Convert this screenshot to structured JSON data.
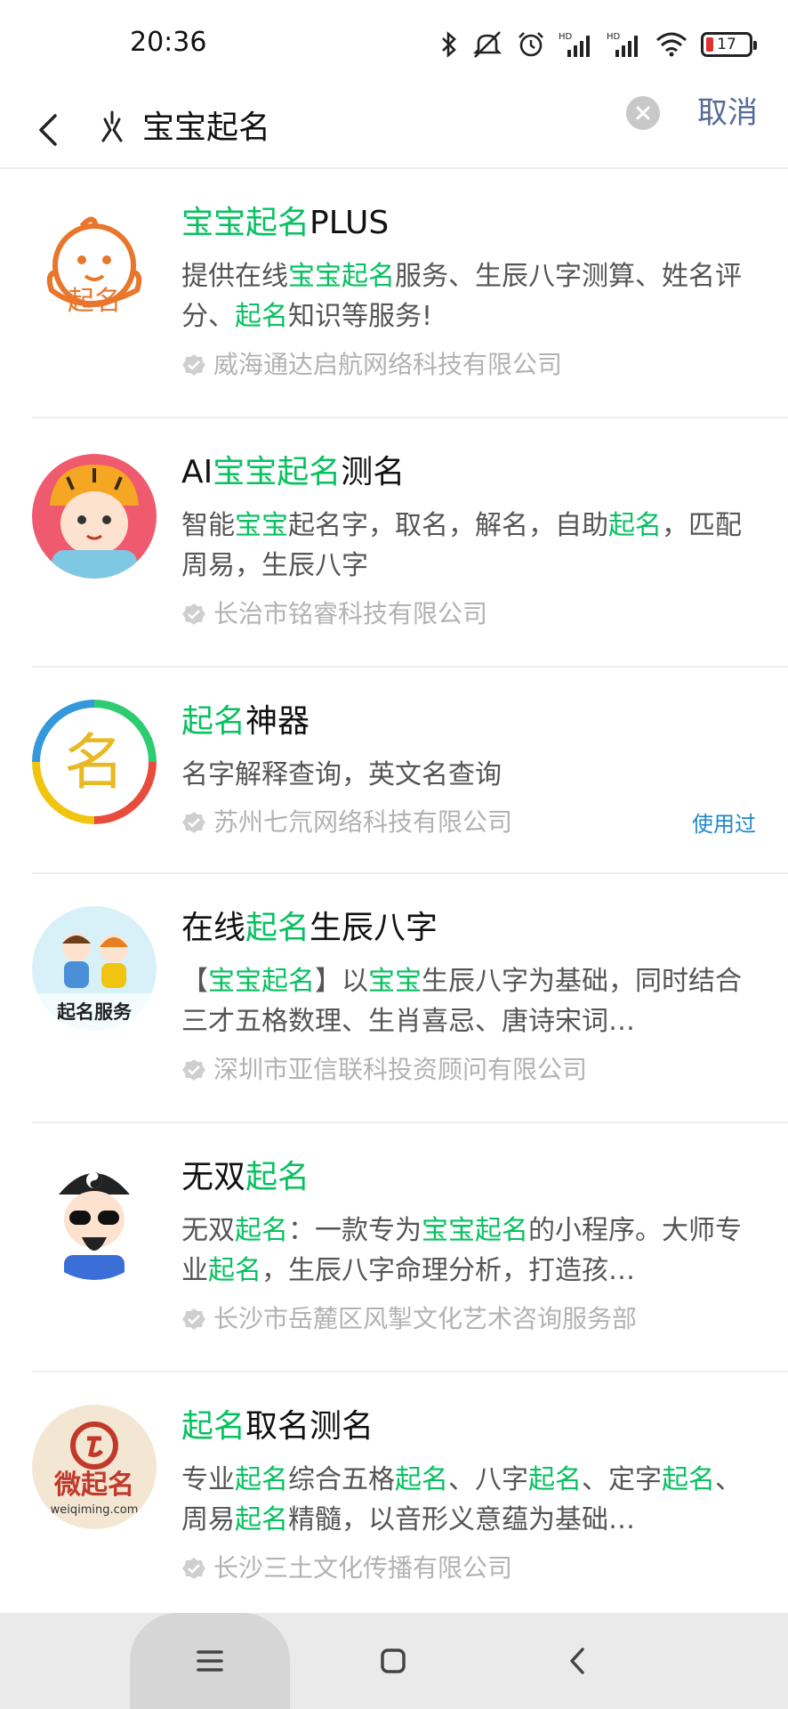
{
  "status_bar": {
    "time": "20:36",
    "battery": "17",
    "icons": [
      "bluetooth-icon",
      "mute-icon",
      "alarm-icon",
      "signal-hd-icon",
      "signal-hd-icon",
      "wifi-icon",
      "battery-icon"
    ]
  },
  "search": {
    "query": "宝宝起名",
    "cancel_label": "取消"
  },
  "results": [
    {
      "title": [
        {
          "t": "宝宝起名",
          "h": true
        },
        {
          "t": "PLUS",
          "h": false
        }
      ],
      "desc": [
        {
          "t": "提供在线",
          "h": false
        },
        {
          "t": "宝宝起名",
          "h": true
        },
        {
          "t": "服务、生辰八字测算、姓名评分、",
          "h": false
        },
        {
          "t": "起名",
          "h": true
        },
        {
          "t": "知识等服务!",
          "h": false
        }
      ],
      "company": "威海通达启航网络科技有限公司",
      "used": ""
    },
    {
      "title": [
        {
          "t": "AI",
          "h": false
        },
        {
          "t": "宝宝起名",
          "h": true
        },
        {
          "t": "测名",
          "h": false
        }
      ],
      "desc": [
        {
          "t": "智能",
          "h": false
        },
        {
          "t": "宝宝",
          "h": true
        },
        {
          "t": "起名字，取名，解名，自助",
          "h": false
        },
        {
          "t": "起名",
          "h": true
        },
        {
          "t": "，匹配周易，生辰八字",
          "h": false
        }
      ],
      "company": "长治市铭睿科技有限公司",
      "used": ""
    },
    {
      "title": [
        {
          "t": "起名",
          "h": true
        },
        {
          "t": "神器",
          "h": false
        }
      ],
      "desc": [
        {
          "t": "名字解释查询，英文名查询",
          "h": false
        }
      ],
      "company": "苏州七氘网络科技有限公司",
      "used": "使用过"
    },
    {
      "title": [
        {
          "t": "在线",
          "h": false
        },
        {
          "t": "起名",
          "h": true
        },
        {
          "t": "生辰八字",
          "h": false
        }
      ],
      "desc": [
        {
          "t": "【",
          "h": false
        },
        {
          "t": "宝宝起名",
          "h": true
        },
        {
          "t": "】以",
          "h": false
        },
        {
          "t": "宝宝",
          "h": true
        },
        {
          "t": "生辰八字为基础，同时结合三才五格数理、生肖喜忌、唐诗宋词…",
          "h": false
        }
      ],
      "company": "深圳市亚信联科投资顾问有限公司",
      "used": "",
      "avatar_text": "起名服务"
    },
    {
      "title": [
        {
          "t": "无双",
          "h": false
        },
        {
          "t": "起名",
          "h": true
        }
      ],
      "desc": [
        {
          "t": "无双",
          "h": false
        },
        {
          "t": "起名",
          "h": true
        },
        {
          "t": "：一款专为",
          "h": false
        },
        {
          "t": "宝宝起名",
          "h": true
        },
        {
          "t": "的小程序。大师专业",
          "h": false
        },
        {
          "t": "起名",
          "h": true
        },
        {
          "t": "，生辰八字命理分析，打造孩…",
          "h": false
        }
      ],
      "company": "长沙市岳麓区风掣文化艺术咨询服务部",
      "used": ""
    },
    {
      "title": [
        {
          "t": "起名",
          "h": true
        },
        {
          "t": "取名测名",
          "h": false
        }
      ],
      "desc": [
        {
          "t": "专业",
          "h": false
        },
        {
          "t": "起名",
          "h": true
        },
        {
          "t": "综合五格",
          "h": false
        },
        {
          "t": "起名",
          "h": true
        },
        {
          "t": "、八字",
          "h": false
        },
        {
          "t": "起名",
          "h": true
        },
        {
          "t": "、定字",
          "h": false
        },
        {
          "t": "起名",
          "h": true
        },
        {
          "t": "、周易",
          "h": false
        },
        {
          "t": "起名",
          "h": true
        },
        {
          "t": "精髓，以音形义意蕴为基础…",
          "h": false
        }
      ],
      "company": "长沙三土文化传播有限公司",
      "used": "",
      "avatar_text": "微起名",
      "avatar_sub": "weiqiming.com"
    }
  ],
  "logo_text": {
    "r0": "起名",
    "r2": "名"
  },
  "colors": {
    "highlight": "#07c160",
    "link": "#576b95",
    "used": "#1e88c8"
  }
}
